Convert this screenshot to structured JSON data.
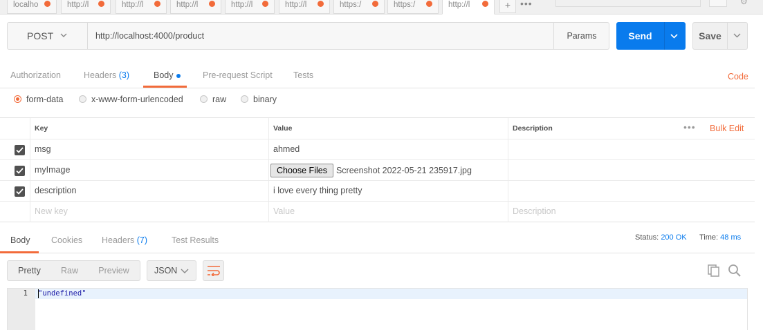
{
  "tabs": [
    {
      "label": "localho",
      "active": false
    },
    {
      "label": "http://l",
      "active": false
    },
    {
      "label": "http://l",
      "active": false
    },
    {
      "label": "http://l",
      "active": false
    },
    {
      "label": "http://l",
      "active": false
    },
    {
      "label": "http://l",
      "active": false
    },
    {
      "label": "https:/",
      "active": false
    },
    {
      "label": "https:/",
      "active": false
    },
    {
      "label": "http://l",
      "active": true
    }
  ],
  "tab_add_label": "+",
  "tab_more_label": "•••",
  "request": {
    "method": "POST",
    "url": "http://localhost:4000/product",
    "params_label": "Params",
    "send_label": "Send",
    "save_label": "Save"
  },
  "request_tabs": {
    "authorization": "Authorization",
    "headers": "Headers",
    "headers_count": "(3)",
    "body": "Body",
    "prerequest": "Pre-request Script",
    "tests": "Tests",
    "code": "Code"
  },
  "body_types": {
    "form_data": "form-data",
    "urlencoded": "x-www-form-urlencoded",
    "raw": "raw",
    "binary": "binary",
    "selected": "form-data"
  },
  "params_table": {
    "headers": {
      "key": "Key",
      "value": "Value",
      "description": "Description",
      "more": "•••",
      "bulk_edit": "Bulk Edit"
    },
    "rows": [
      {
        "checked": true,
        "key": "msg",
        "value": "ahmed",
        "description": ""
      },
      {
        "checked": true,
        "key": "myImage",
        "file_button": "Choose Files",
        "value": "Screenshot 2022-05-21 235917.jpg",
        "description": ""
      },
      {
        "checked": true,
        "key": "description",
        "value": "i love every thing pretty",
        "description": ""
      }
    ],
    "placeholders": {
      "key": "New key",
      "value": "Value",
      "description": "Description"
    }
  },
  "response": {
    "tabs": {
      "body": "Body",
      "cookies": "Cookies",
      "headers": "Headers",
      "headers_count": "(7)",
      "test_results": "Test Results"
    },
    "status_label": "Status:",
    "status_value": "200 OK",
    "time_label": "Time:",
    "time_value": "48 ms",
    "view_modes": {
      "pretty": "Pretty",
      "raw": "Raw",
      "preview": "Preview",
      "selected": "Pretty"
    },
    "format": "JSON",
    "line_number": "1",
    "code": "\"undefined\""
  },
  "colors": {
    "accent": "#f26b3a",
    "primary": "#097bed"
  }
}
